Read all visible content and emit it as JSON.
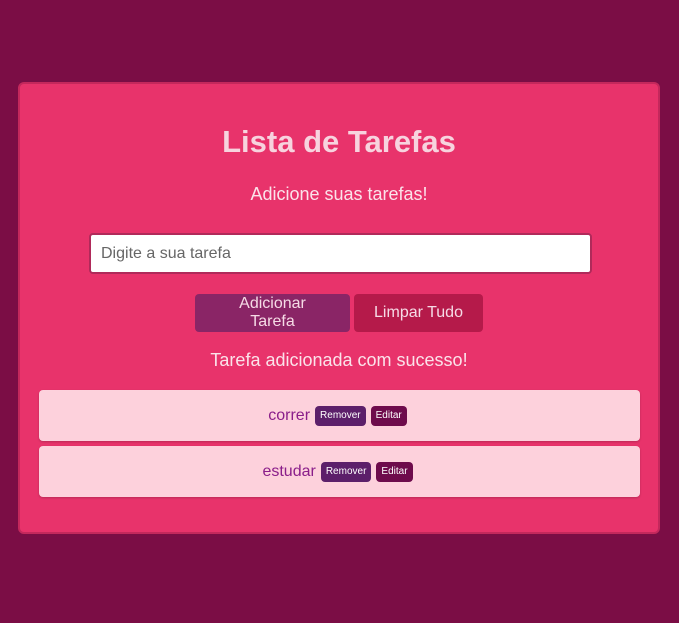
{
  "app": {
    "title": "Lista de Tarefas",
    "subtitle": "Adicione suas tarefas!"
  },
  "input": {
    "placeholder": "Digite a sua tarefa",
    "value": ""
  },
  "buttons": {
    "add_label": "Adicionar Tarefa",
    "clear_label": "Limpar Tudo"
  },
  "status_message": "Tarefa adicionada com sucesso!",
  "tasks": [
    {
      "text": "correr",
      "remove_label": "Remover",
      "edit_label": "Editar"
    },
    {
      "text": "estudar",
      "remove_label": "Remover",
      "edit_label": "Editar"
    }
  ],
  "colors": {
    "page_background": "#7b0d45",
    "card_background": "#e8336b",
    "add_button": "#8a2566",
    "clear_button": "#b51a4a",
    "task_background": "#fdd1dc",
    "remove_button": "#5c1f6a",
    "edit_button": "#6e0b4c"
  }
}
